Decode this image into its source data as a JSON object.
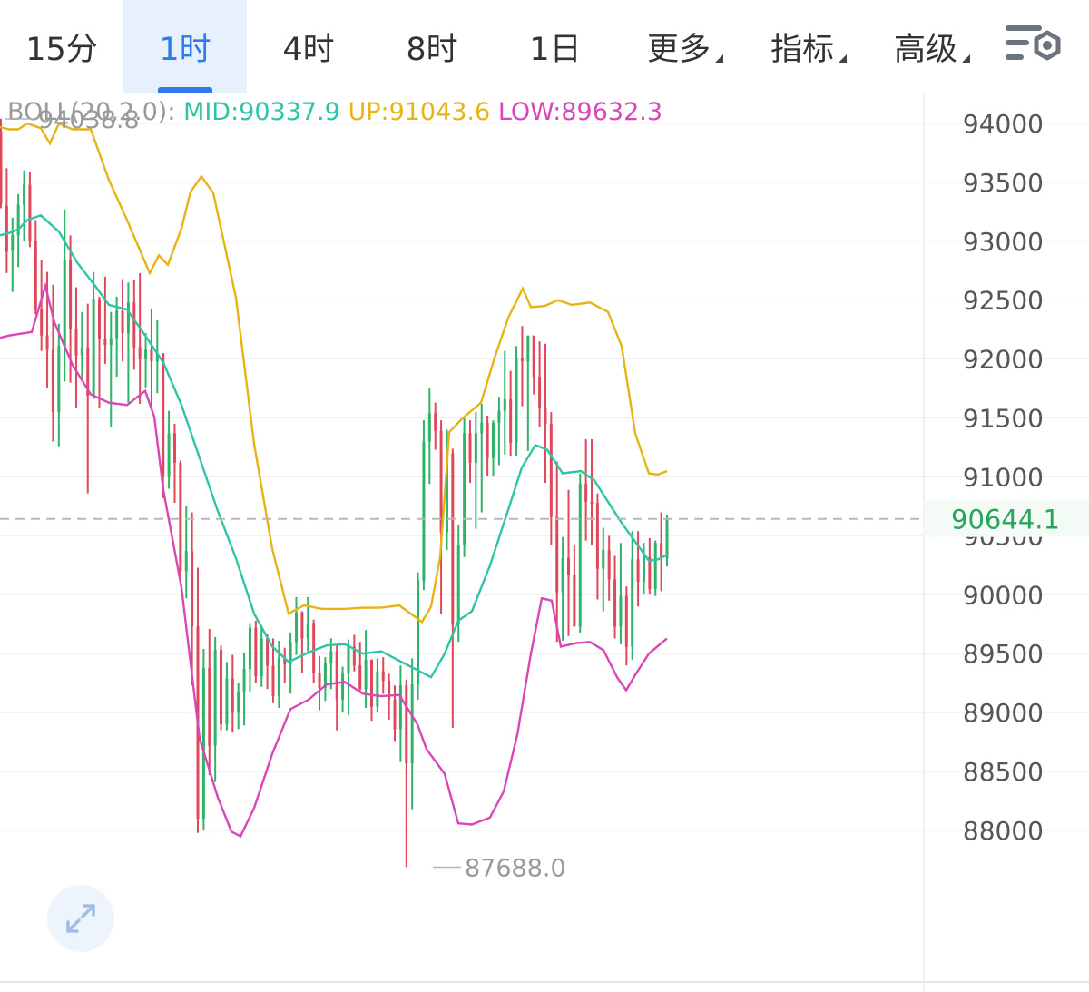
{
  "tabs": [
    {
      "label": "15分",
      "active": false,
      "dropdown": false
    },
    {
      "label": "1时",
      "active": true,
      "dropdown": false
    },
    {
      "label": "4时",
      "active": false,
      "dropdown": false
    },
    {
      "label": "8时",
      "active": false,
      "dropdown": false
    },
    {
      "label": "1日",
      "active": false,
      "dropdown": false
    },
    {
      "label": "更多",
      "active": false,
      "dropdown": true
    },
    {
      "label": "指标",
      "active": false,
      "dropdown": true
    },
    {
      "label": "高级",
      "active": false,
      "dropdown": true
    }
  ],
  "settings_icon": "chart-settings-icon",
  "indicator": {
    "name": "BOLL(20,2.0):",
    "mid": "MID:90337.9",
    "up": "UP:91043.6",
    "low": "LOW:89632.3"
  },
  "chart_data": {
    "type": "candlestick",
    "y_ticks": [
      "94000",
      "93500",
      "93000",
      "92500",
      "92000",
      "91500",
      "91000",
      "90500",
      "90000",
      "89500",
      "89000",
      "88500",
      "88000"
    ],
    "ylim": [
      87600,
      94700
    ],
    "current_price": "90644.1",
    "high_marker": "94038.8",
    "low_marker": "87688.0",
    "colors": {
      "up": "#2fb36a",
      "down": "#e0475a",
      "mid": "#2ec4a5",
      "upper": "#e6b417",
      "lower": "#d946b8",
      "current": "#29a55a",
      "axis_text": "#555555",
      "grid": "#eeeeee"
    },
    "candles": [
      [
        93930,
        94040,
        93280,
        93320
      ],
      [
        93300,
        93620,
        92730,
        92910
      ],
      [
        92920,
        93200,
        92570,
        93050
      ],
      [
        93050,
        93400,
        92780,
        93310
      ],
      [
        93310,
        93600,
        93000,
        93480
      ],
      [
        93480,
        93590,
        92950,
        93000
      ],
      [
        93000,
        93180,
        92380,
        92420
      ],
      [
        92420,
        92840,
        92070,
        92200
      ],
      [
        92200,
        92740,
        91750,
        92080
      ],
      [
        92080,
        92630,
        91300,
        91550
      ],
      [
        91550,
        92300,
        91260,
        92110
      ],
      [
        92110,
        93270,
        91810,
        92840
      ],
      [
        92840,
        93050,
        91800,
        92260
      ],
      [
        92260,
        92610,
        91590,
        92030
      ],
      [
        92030,
        92400,
        91840,
        92100
      ],
      [
        92100,
        92470,
        90860,
        91690
      ],
      [
        91690,
        92740,
        91660,
        92510
      ],
      [
        92510,
        92530,
        91590,
        92170
      ],
      [
        92170,
        92700,
        91960,
        92120
      ],
      [
        92120,
        92400,
        91420,
        92180
      ],
      [
        92180,
        92530,
        91850,
        92410
      ],
      [
        92410,
        92680,
        91980,
        92220
      ],
      [
        92220,
        92650,
        91630,
        92480
      ],
      [
        92480,
        92670,
        91910,
        92100
      ],
      [
        92100,
        92730,
        91620,
        92000
      ],
      [
        92000,
        92220,
        91760,
        92080
      ],
      [
        92080,
        92430,
        91600,
        91980
      ],
      [
        91980,
        92330,
        91710,
        92050
      ],
      [
        92050,
        92050,
        90820,
        91000
      ],
      [
        91000,
        91560,
        90900,
        91370
      ],
      [
        91370,
        91450,
        90780,
        91120
      ],
      [
        91120,
        91140,
        90130,
        90200
      ],
      [
        90200,
        90750,
        89970,
        90370
      ],
      [
        90370,
        90700,
        89230,
        89730
      ],
      [
        89730,
        90230,
        87980,
        88100
      ],
      [
        88100,
        89540,
        88000,
        89380
      ],
      [
        89380,
        89710,
        88470,
        88720
      ],
      [
        88720,
        89640,
        88410,
        89530
      ],
      [
        89530,
        89570,
        88850,
        88900
      ],
      [
        88900,
        89430,
        88850,
        89290
      ],
      [
        89290,
        89490,
        88830,
        89000
      ],
      [
        89000,
        89250,
        88860,
        89180
      ],
      [
        89180,
        89510,
        88890,
        89370
      ],
      [
        89370,
        89760,
        89170,
        89720
      ],
      [
        89720,
        89780,
        89250,
        89310
      ],
      [
        89310,
        89740,
        89220,
        89630
      ],
      [
        89630,
        89670,
        89200,
        89400
      ],
      [
        89400,
        89630,
        89080,
        89140
      ],
      [
        89140,
        89610,
        89040,
        89460
      ],
      [
        89460,
        89550,
        89250,
        89410
      ],
      [
        89410,
        89680,
        89160,
        89600
      ],
      [
        89600,
        89980,
        89490,
        89850
      ],
      [
        89850,
        89860,
        89340,
        89630
      ],
      [
        89630,
        89980,
        89520,
        89760
      ],
      [
        89760,
        89790,
        89250,
        89340
      ],
      [
        89340,
        89480,
        89020,
        89210
      ],
      [
        89210,
        89470,
        89100,
        89420
      ],
      [
        89420,
        89630,
        89200,
        89520
      ],
      [
        89520,
        89580,
        88850,
        89110
      ],
      [
        89110,
        89390,
        89000,
        89330
      ],
      [
        89330,
        89620,
        88980,
        89560
      ],
      [
        89560,
        89660,
        89350,
        89400
      ],
      [
        89400,
        89600,
        89170,
        89200
      ],
      [
        89200,
        89700,
        89040,
        89450
      ],
      [
        89450,
        89450,
        88930,
        89050
      ],
      [
        89050,
        89460,
        89000,
        89350
      ],
      [
        89350,
        89470,
        89160,
        89270
      ],
      [
        89270,
        89330,
        88940,
        89110
      ],
      [
        89110,
        89230,
        88760,
        88860
      ],
      [
        88860,
        89400,
        88580,
        89230
      ],
      [
        89230,
        89280,
        87690,
        88570
      ],
      [
        88570,
        89460,
        88180,
        89240
      ],
      [
        89240,
        90190,
        89110,
        90120
      ],
      [
        90120,
        91480,
        90040,
        91300
      ],
      [
        91300,
        91750,
        90940,
        91540
      ],
      [
        91540,
        91630,
        91230,
        91390
      ],
      [
        91390,
        91480,
        89840,
        90530
      ],
      [
        90530,
        91400,
        90380,
        91200
      ],
      [
        91200,
        91240,
        88870,
        89750
      ],
      [
        89750,
        90590,
        89600,
        90420
      ],
      [
        90420,
        91500,
        90320,
        91370
      ],
      [
        91370,
        91480,
        90950,
        91120
      ],
      [
        91120,
        91550,
        90560,
        91370
      ],
      [
        91370,
        91620,
        90700,
        91460
      ],
      [
        91460,
        91520,
        91010,
        91160
      ],
      [
        91160,
        91480,
        91010,
        91460
      ],
      [
        91460,
        91680,
        91100,
        91560
      ],
      [
        91560,
        92070,
        91190,
        91660
      ],
      [
        91660,
        91900,
        91180,
        91290
      ],
      [
        91290,
        92110,
        91180,
        92010
      ],
      [
        92010,
        92280,
        91600,
        91980
      ],
      [
        91980,
        92160,
        91220,
        92200
      ],
      [
        92200,
        92170,
        91700,
        91850
      ],
      [
        91850,
        92150,
        91420,
        91590
      ],
      [
        91590,
        92130,
        90950,
        91450
      ],
      [
        91450,
        91550,
        90420,
        90660
      ],
      [
        90660,
        91130,
        89600,
        90020
      ],
      [
        90020,
        90490,
        89610,
        90310
      ],
      [
        90310,
        90890,
        89650,
        90170
      ],
      [
        90170,
        90420,
        89750,
        89730
      ],
      [
        89730,
        91030,
        89680,
        90940
      ],
      [
        90940,
        91320,
        90460,
        90790
      ],
      [
        90790,
        91320,
        90420,
        90780
      ],
      [
        90780,
        90860,
        89960,
        90220
      ],
      [
        90220,
        90570,
        89860,
        90380
      ],
      [
        90380,
        90500,
        89950,
        90130
      ],
      [
        90130,
        90330,
        89630,
        89730
      ],
      [
        89730,
        90440,
        89580,
        89990
      ],
      [
        89990,
        90070,
        89400,
        89560
      ],
      [
        89560,
        90540,
        89450,
        90300
      ],
      [
        90300,
        90540,
        89900,
        90110
      ],
      [
        90110,
        90440,
        90010,
        90320
      ],
      [
        90320,
        90480,
        90010,
        90050
      ],
      [
        90050,
        90460,
        89990,
        90440
      ],
      [
        90440,
        90700,
        90030,
        90310
      ],
      [
        90310,
        90680,
        90240,
        90644.1
      ]
    ],
    "mid": [
      [
        0,
        93050
      ],
      [
        10,
        93070
      ],
      [
        20,
        93100
      ],
      [
        30,
        93180
      ],
      [
        45,
        93220
      ],
      [
        65,
        93080
      ],
      [
        85,
        92820
      ],
      [
        105,
        92620
      ],
      [
        120,
        92460
      ],
      [
        140,
        92420
      ],
      [
        160,
        92200
      ],
      [
        180,
        91970
      ],
      [
        200,
        91610
      ],
      [
        220,
        91160
      ],
      [
        240,
        90710
      ],
      [
        260,
        90310
      ],
      [
        280,
        89840
      ],
      [
        300,
        89560
      ],
      [
        318,
        89430
      ],
      [
        340,
        89510
      ],
      [
        360,
        89570
      ],
      [
        380,
        89580
      ],
      [
        400,
        89500
      ],
      [
        420,
        89520
      ],
      [
        440,
        89440
      ],
      [
        460,
        89360
      ],
      [
        475,
        89300
      ],
      [
        490,
        89500
      ],
      [
        505,
        89780
      ],
      [
        520,
        89860
      ],
      [
        540,
        90250
      ],
      [
        560,
        90720
      ],
      [
        575,
        91080
      ],
      [
        590,
        91270
      ],
      [
        603,
        91230
      ],
      [
        620,
        91030
      ],
      [
        640,
        91050
      ],
      [
        655,
        90970
      ],
      [
        670,
        90790
      ],
      [
        685,
        90610
      ],
      [
        700,
        90450
      ],
      [
        715,
        90290
      ],
      [
        725,
        90300
      ],
      [
        735,
        90340
      ]
    ],
    "upper": [
      [
        0,
        93970
      ],
      [
        10,
        93950
      ],
      [
        20,
        93950
      ],
      [
        30,
        94000
      ],
      [
        45,
        93960
      ],
      [
        55,
        93830
      ],
      [
        65,
        94000
      ],
      [
        80,
        93950
      ],
      [
        100,
        93950
      ],
      [
        120,
        93520
      ],
      [
        140,
        93180
      ],
      [
        165,
        92730
      ],
      [
        175,
        92880
      ],
      [
        185,
        92800
      ],
      [
        200,
        93110
      ],
      [
        210,
        93420
      ],
      [
        222,
        93550
      ],
      [
        235,
        93410
      ],
      [
        260,
        92520
      ],
      [
        280,
        91280
      ],
      [
        300,
        90390
      ],
      [
        318,
        89840
      ],
      [
        335,
        89910
      ],
      [
        355,
        89880
      ],
      [
        380,
        89880
      ],
      [
        400,
        89890
      ],
      [
        420,
        89890
      ],
      [
        440,
        89910
      ],
      [
        465,
        89770
      ],
      [
        475,
        89900
      ],
      [
        485,
        90320
      ],
      [
        495,
        91380
      ],
      [
        510,
        91500
      ],
      [
        530,
        91630
      ],
      [
        545,
        92010
      ],
      [
        560,
        92350
      ],
      [
        576,
        92600
      ],
      [
        585,
        92440
      ],
      [
        600,
        92450
      ],
      [
        615,
        92500
      ],
      [
        630,
        92460
      ],
      [
        650,
        92480
      ],
      [
        670,
        92400
      ],
      [
        685,
        92110
      ],
      [
        700,
        91370
      ],
      [
        715,
        91030
      ],
      [
        725,
        91020
      ],
      [
        735,
        91050
      ]
    ],
    "lower": [
      [
        0,
        92180
      ],
      [
        10,
        92200
      ],
      [
        35,
        92230
      ],
      [
        50,
        92620
      ],
      [
        60,
        92310
      ],
      [
        80,
        91950
      ],
      [
        100,
        91700
      ],
      [
        120,
        91630
      ],
      [
        140,
        91610
      ],
      [
        160,
        91730
      ],
      [
        170,
        91510
      ],
      [
        180,
        90890
      ],
      [
        200,
        90060
      ],
      [
        220,
        88780
      ],
      [
        240,
        88280
      ],
      [
        255,
        87990
      ],
      [
        265,
        87950
      ],
      [
        280,
        88190
      ],
      [
        300,
        88650
      ],
      [
        320,
        89030
      ],
      [
        340,
        89110
      ],
      [
        360,
        89240
      ],
      [
        380,
        89260
      ],
      [
        400,
        89160
      ],
      [
        420,
        89140
      ],
      [
        440,
        89150
      ],
      [
        460,
        88900
      ],
      [
        470,
        88690
      ],
      [
        490,
        88480
      ],
      [
        505,
        88060
      ],
      [
        520,
        88050
      ],
      [
        540,
        88110
      ],
      [
        555,
        88330
      ],
      [
        570,
        88810
      ],
      [
        585,
        89500
      ],
      [
        597,
        89970
      ],
      [
        608,
        89950
      ],
      [
        618,
        89560
      ],
      [
        635,
        89590
      ],
      [
        650,
        89600
      ],
      [
        665,
        89530
      ],
      [
        680,
        89300
      ],
      [
        690,
        89190
      ],
      [
        700,
        89320
      ],
      [
        715,
        89500
      ],
      [
        735,
        89630
      ]
    ]
  }
}
